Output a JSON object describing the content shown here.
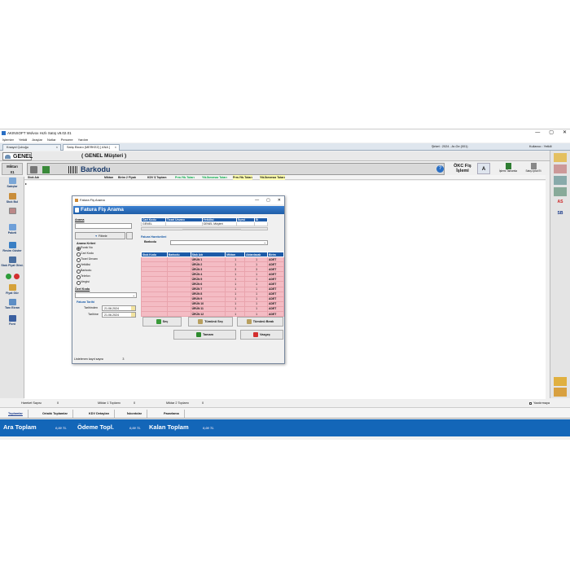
{
  "window": {
    "title": "AKINSOFT Wolvox Hızlı Satış v9.02.01",
    "controls": [
      "—",
      "▢",
      "✕"
    ]
  },
  "menu": [
    "İşlemler",
    "Yetkili",
    "Araçlar",
    "Notlar",
    "Pencere",
    "Yardım"
  ],
  "tabs": [
    {
      "label": "Kısayol Çubuğu"
    },
    {
      "label": "Satış Ekranı (MERKEZ) [ ANA ]"
    }
  ],
  "info": {
    "sube": "Şirket : 2024 - Ar-Ge (001)",
    "kullanici": "Kullanıcı : Yetkili"
  },
  "customer": {
    "code": "GENEL",
    "name": "( GENEL Müşteri )"
  },
  "barcode": {
    "miktar_label": "Miktarı",
    "miktar_value": "X1",
    "label": "Barkodu"
  },
  "okc": {
    "label": "ÖKC Fiş İşlemi",
    "a_label": "A",
    "tamamla": "İşlemi Tamamla",
    "iptal": "Satışı İptal Et"
  },
  "columns": [
    "Stok Adı",
    "Miktarı",
    "Birim 2 Fiyatı",
    "KDV $ Toplam",
    "Prm.Ytk.Tutarı",
    "Ytk.İkmenaz Tutarı",
    "Prm.Ytk.Tutarı",
    "Ytk.İkmenaz Tutarı"
  ],
  "left_buttons": [
    "Satışlar",
    "Stok Bul",
    "",
    "Paketi",
    "Resim Göster",
    "Stok Fiyat Göst.",
    "",
    "Fiyat Gör",
    "Tanı Ekran",
    "Font"
  ],
  "right_buttons": [
    "AS",
    "SB"
  ],
  "status": {
    "hareket_label": "Hareket Sayısı",
    "hareket": "0",
    "miktar1_label": "Miktar 1 Toplamı",
    "miktar1": "0",
    "miktar2_label": "Miktar 2 Toplamı",
    "miktar2": "0",
    "yazdir": "Yazdırmaya Gönder"
  },
  "bottom_tabs": [
    "Toplamlar",
    "Ortalık Toplamlar",
    "KDV Detayları",
    "İskontolar",
    "Pazarlama"
  ],
  "totals": [
    {
      "label": "Ara Toplam",
      "value": "0,00 TL"
    },
    {
      "label": "Ödeme Topl.",
      "value": "0,00 TL"
    },
    {
      "label": "Kalan Toplam",
      "value": "0,00 TL"
    }
  ],
  "dialog": {
    "title": "Fatura Fiş Arama",
    "header": "Fatura Fiş Arama",
    "arama_label": "Arama",
    "filtrele": "Filtrele",
    "kriter_label": "Arama Kriteri",
    "criteria": [
      "Evrak No",
      "Cari Kodu",
      "Ticari Ünvanı",
      "Yetkilisi",
      "Barkodu",
      "Telefon",
      "Vergisi"
    ],
    "selected_criterion": 0,
    "ozel_kodu": "Özel Kodu",
    "tarih_label": "Fatura Tarihi",
    "tarih_bas_label": "Tarihinden",
    "tarih_bas": "21.06.2024",
    "tarih_bit_label": "Tarihine",
    "tarih_bit": "21.06.2024",
    "liste_label": "Listelenen kayıt sayısı",
    "liste_count": "3",
    "cari_columns": [
      "Cari Kodu",
      "Ticari Ünvanı",
      "Yetkilisi",
      "İlçesi",
      "İli"
    ],
    "cari_rows": [
      [
        "GENEL",
        "",
        "GENEL Müşteri",
        "",
        ""
      ]
    ],
    "hareket_label": "Fatura Hareketleri",
    "barkodu_label": "Barkodu",
    "item_columns": [
      "Stok Kodu",
      "Barkodu",
      "Stok Adı",
      "Miktarı",
      "Aktarılacak",
      "Birim"
    ],
    "items": [
      [
        "",
        "",
        "ÜRÜN 1",
        "1",
        "1",
        "ADET"
      ],
      [
        "",
        "",
        "ÜRÜN 2",
        "1",
        "1",
        "ADET"
      ],
      [
        "",
        "",
        "ÜRÜN 3",
        "3",
        "3",
        "ADET"
      ],
      [
        "",
        "",
        "ÜRÜN 4",
        "1",
        "1",
        "ADET"
      ],
      [
        "",
        "",
        "ÜRÜN 5",
        "1",
        "1",
        "ADET"
      ],
      [
        "",
        "",
        "ÜRÜN 6",
        "1",
        "1",
        "ADET"
      ],
      [
        "",
        "",
        "ÜRÜN 7",
        "1",
        "1",
        "ADET"
      ],
      [
        "",
        "",
        "ÜRÜN 8",
        "1",
        "1",
        "ADET"
      ],
      [
        "",
        "",
        "ÜRÜN 9",
        "1",
        "1",
        "ADET"
      ],
      [
        "",
        "",
        "ÜRÜN 10",
        "1",
        "1",
        "ADET"
      ],
      [
        "",
        "",
        "ÜRÜN 11",
        "1",
        "1",
        "ADET"
      ],
      [
        "",
        "",
        "ÜRÜN 12",
        "1",
        "1",
        "ADET"
      ]
    ],
    "sec": "Seç",
    "tumunu_sec": "Tümünü Seç",
    "tumunu_bırak": "Tümünü Bırak",
    "tamam": "Tamam",
    "vazgec": "Vazgeç"
  }
}
